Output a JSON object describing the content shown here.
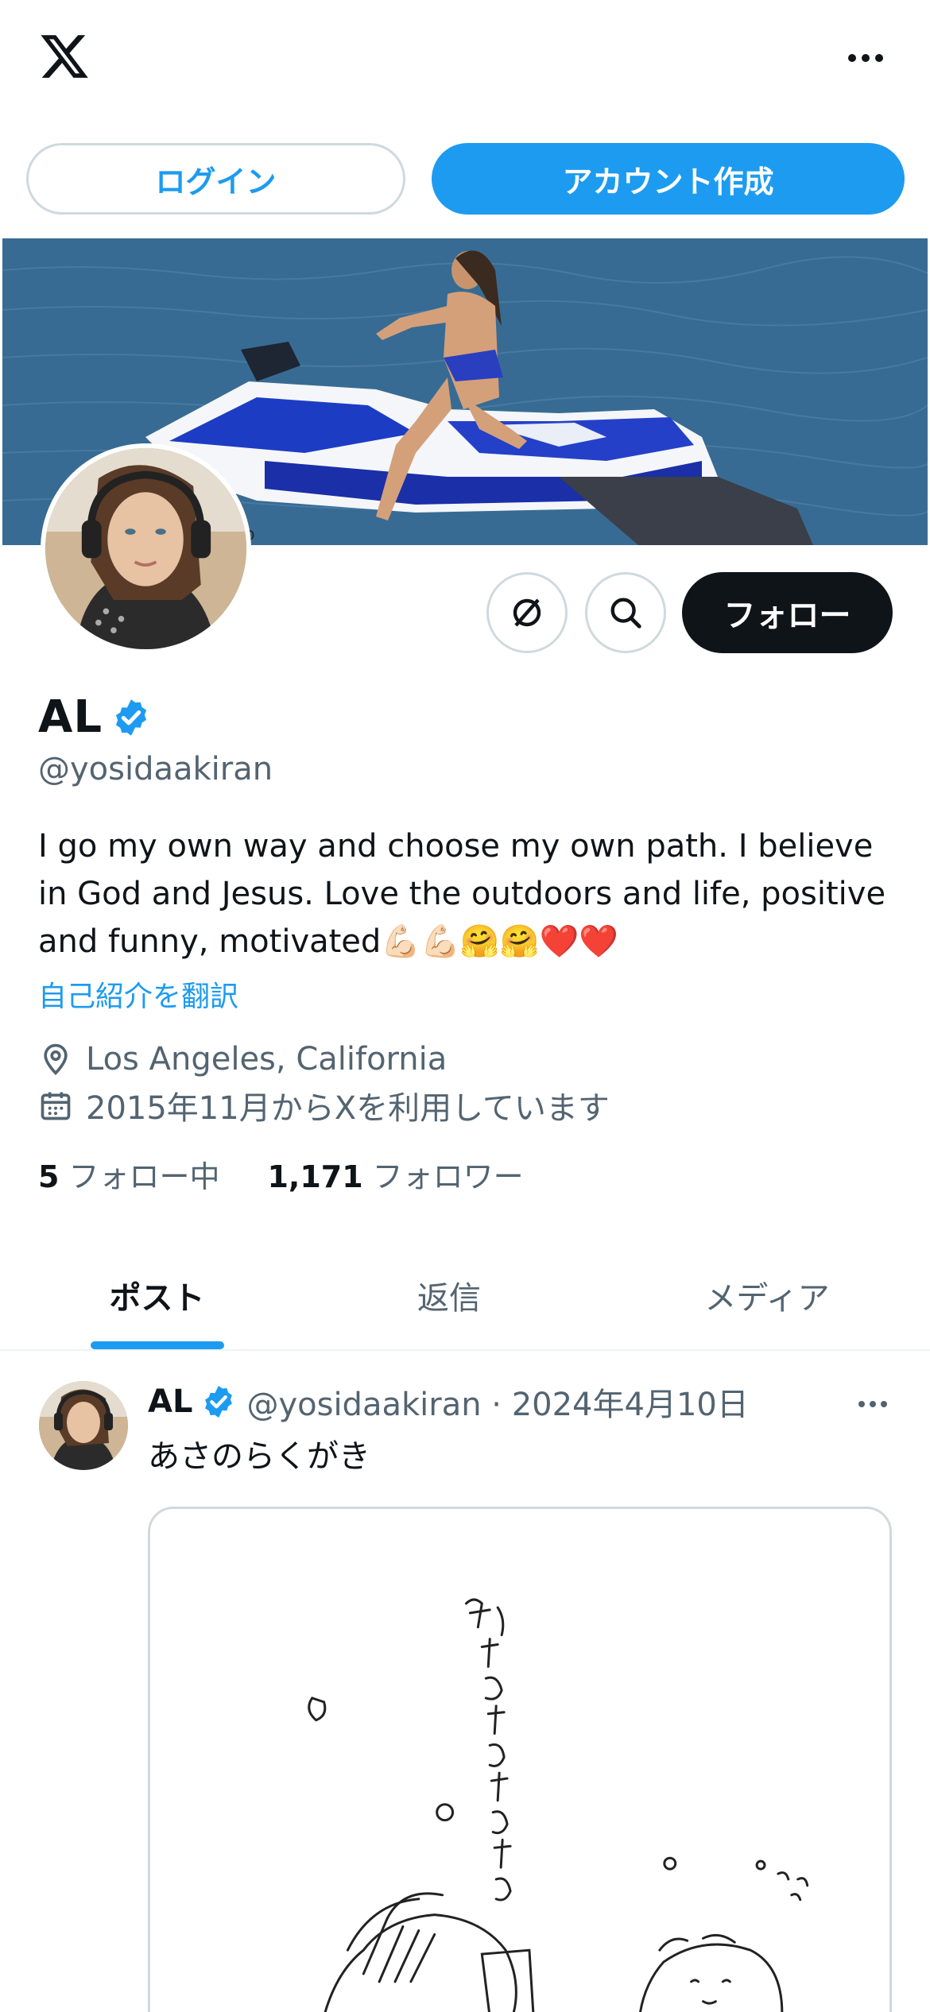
{
  "header": {
    "logo_icon": "x-logo-icon",
    "more_icon": "more-horizontal-icon",
    "login_label": "ログイン",
    "signup_label": "アカウント作成"
  },
  "profile": {
    "display_name": "AL",
    "handle": "@yosidaakiran",
    "bio": "I go my own way and choose my own path. I believe in God and Jesus. Love the outdoors and life, positive and funny, motivated",
    "bio_emoji": "💪🏻💪🏻🤗🤗❤️❤️",
    "translate_label": "自己紹介を翻訳",
    "location": "Los Angeles, California",
    "joined": "2015年11月からXを利用しています",
    "following_count": "5",
    "following_label": "フォロー中",
    "followers_count": "1,171",
    "followers_label": "フォロワー",
    "follow_button": "フォロー"
  },
  "tabs": [
    {
      "label": "ポスト",
      "active": true
    },
    {
      "label": "返信",
      "active": false
    },
    {
      "label": "メディア",
      "active": false
    }
  ],
  "post": {
    "name": "AL",
    "handle_date": "@yosidaakiran · 2024年4月10日",
    "text": "あさのらくがき"
  },
  "colors": {
    "accent": "#1d9bf0",
    "text_primary": "#0f1419",
    "text_secondary": "#536471",
    "border": "#cfd9de"
  }
}
